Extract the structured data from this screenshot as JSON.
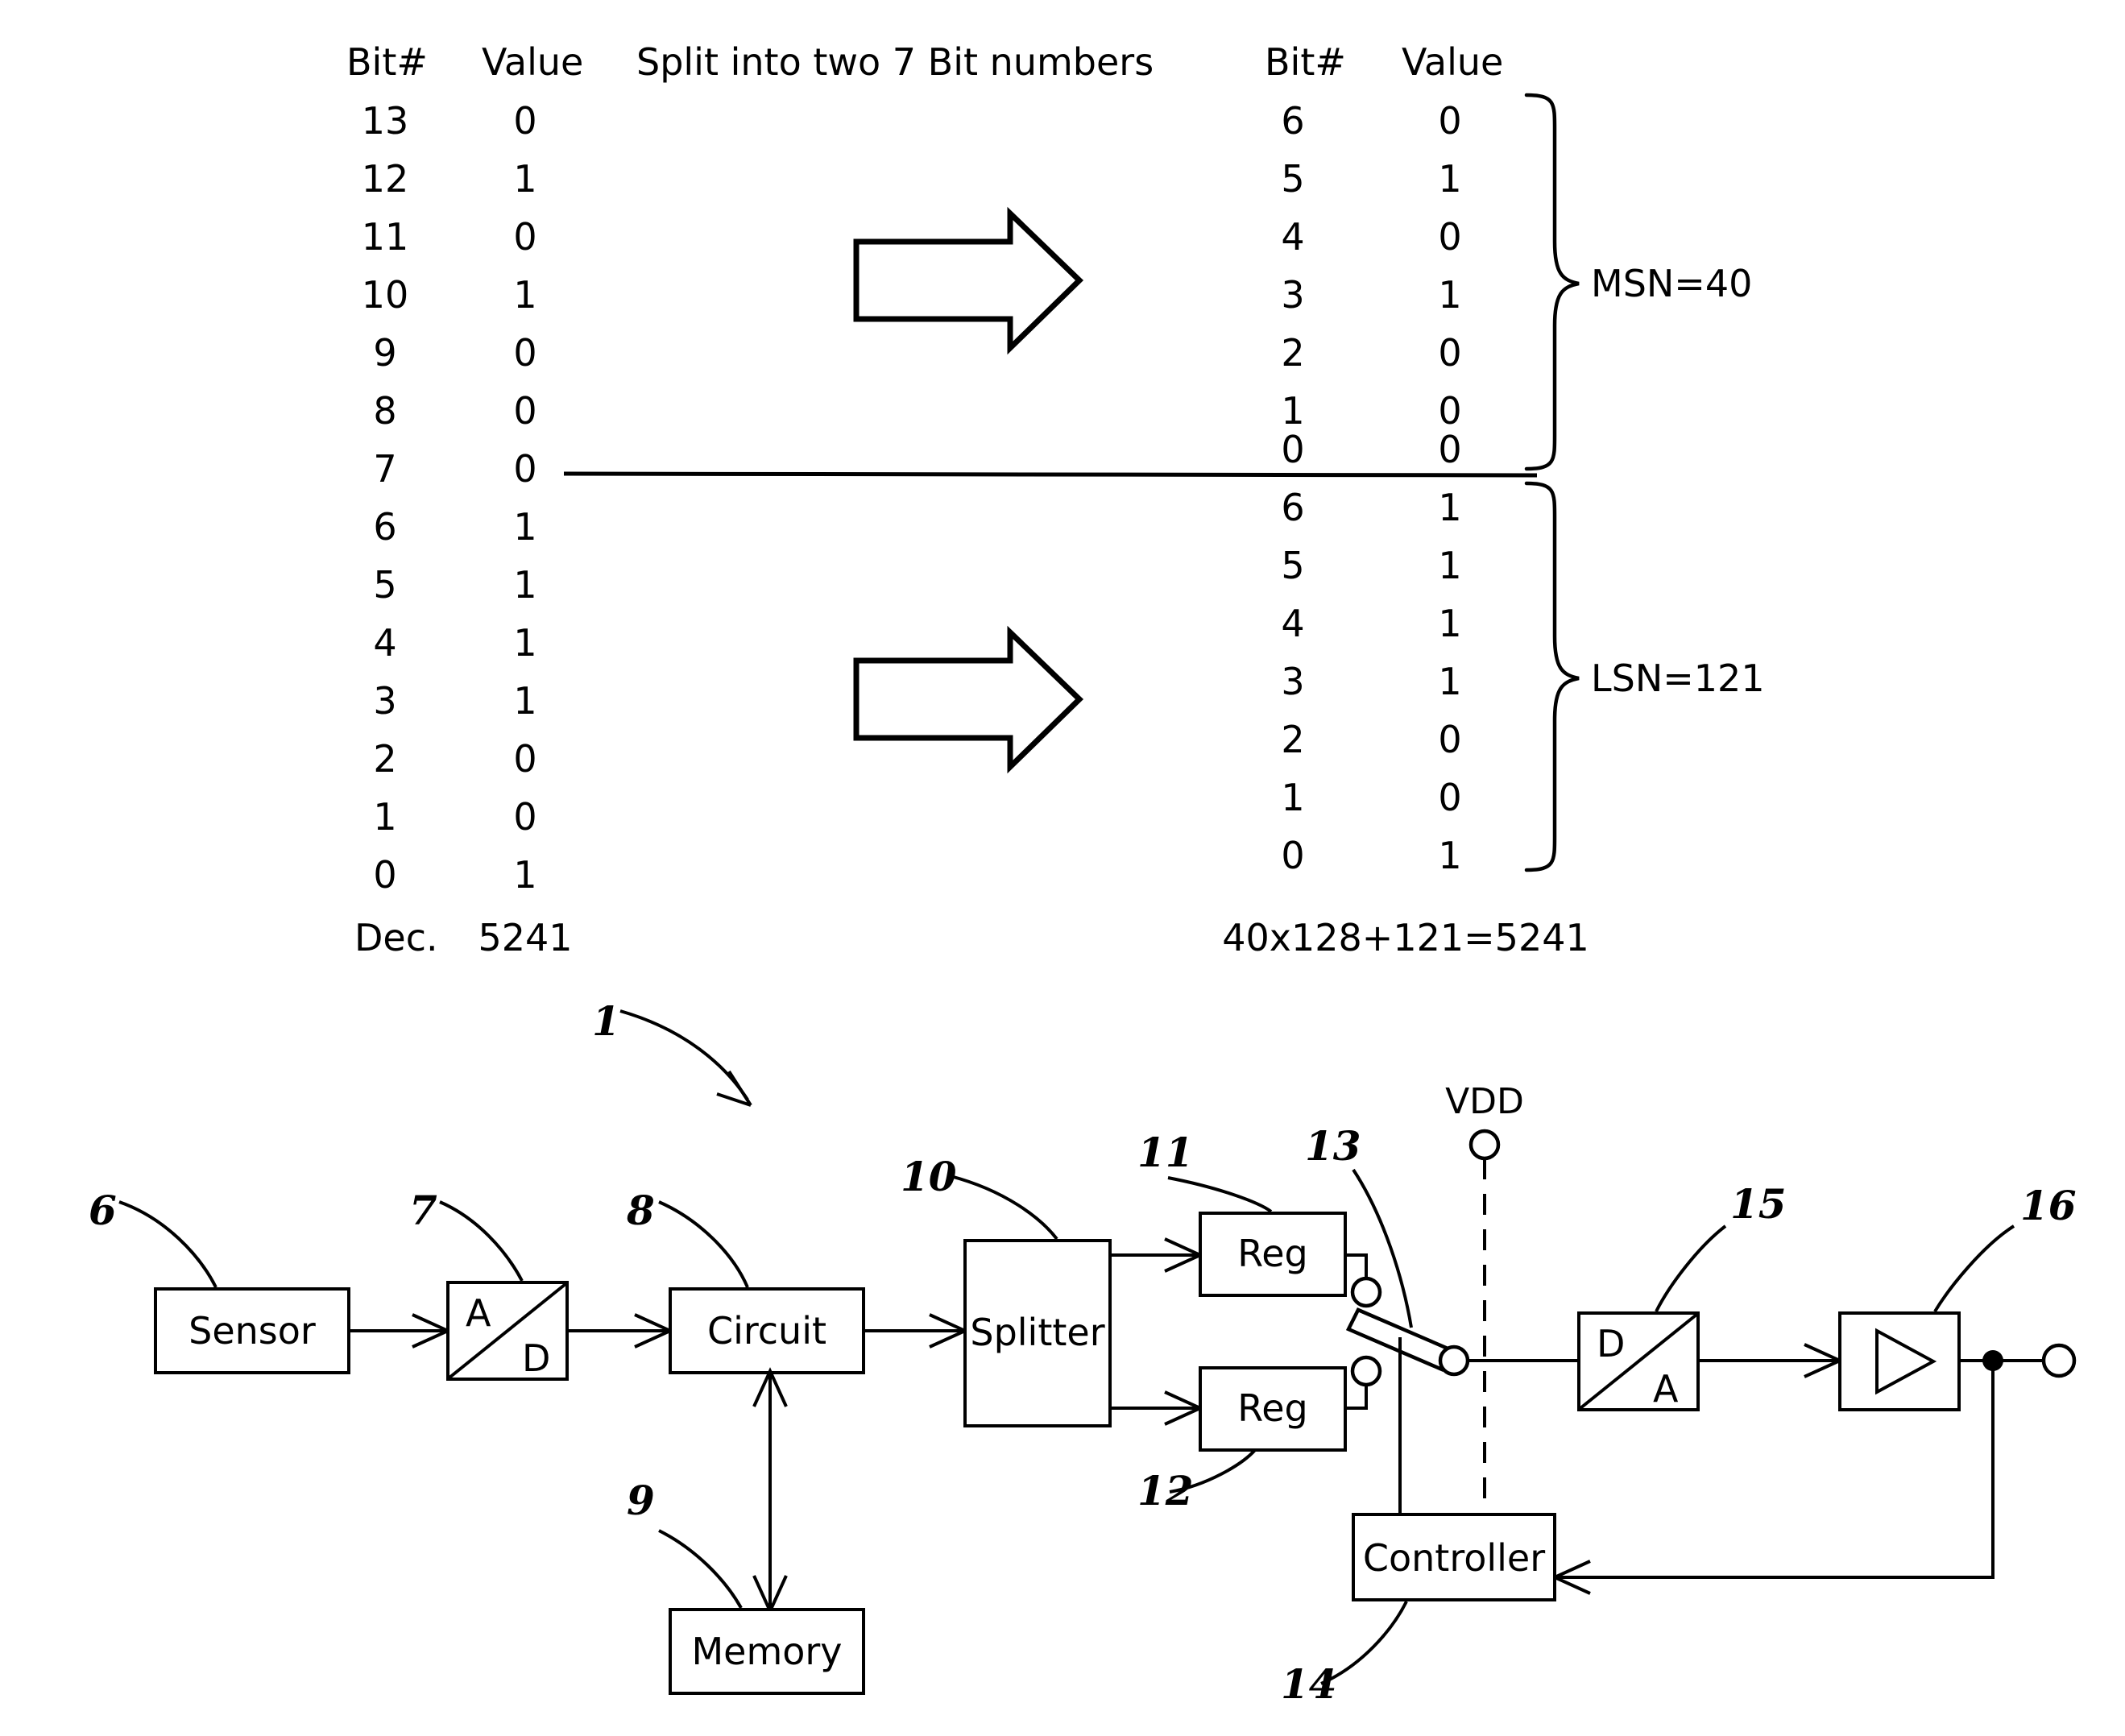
{
  "figure": {
    "title_note": "Split into two 7 Bit numbers"
  },
  "bit_table": {
    "headers": {
      "bit": "Bit#",
      "value": "Value"
    },
    "middle_caption": "Split into two 7 Bit numbers",
    "left": {
      "rows": [
        {
          "bit": "13",
          "value": "0"
        },
        {
          "bit": "12",
          "value": "1"
        },
        {
          "bit": "11",
          "value": "0"
        },
        {
          "bit": "10",
          "value": "1"
        },
        {
          "bit": "9",
          "value": "0"
        },
        {
          "bit": "8",
          "value": "0"
        },
        {
          "bit": "7",
          "value": "0"
        },
        {
          "bit": "6",
          "value": "1"
        },
        {
          "bit": "5",
          "value": "1"
        },
        {
          "bit": "4",
          "value": "1"
        },
        {
          "bit": "3",
          "value": "1"
        },
        {
          "bit": "2",
          "value": "0"
        },
        {
          "bit": "1",
          "value": "0"
        },
        {
          "bit": "0",
          "value": "1"
        }
      ],
      "footer_label": "Dec.",
      "footer_value": "5241"
    },
    "right": {
      "msn_rows": [
        {
          "bit": "6",
          "value": "0"
        },
        {
          "bit": "5",
          "value": "1"
        },
        {
          "bit": "4",
          "value": "0"
        },
        {
          "bit": "3",
          "value": "1"
        },
        {
          "bit": "2",
          "value": "0"
        },
        {
          "bit": "1",
          "value": "0"
        },
        {
          "bit": "0",
          "value": "0"
        }
      ],
      "lsn_rows": [
        {
          "bit": "6",
          "value": "1"
        },
        {
          "bit": "5",
          "value": "1"
        },
        {
          "bit": "4",
          "value": "1"
        },
        {
          "bit": "3",
          "value": "1"
        },
        {
          "bit": "2",
          "value": "0"
        },
        {
          "bit": "1",
          "value": "0"
        },
        {
          "bit": "0",
          "value": "1"
        }
      ],
      "msn_label": "MSN=40",
      "lsn_label": "LSN=121",
      "footer_equation": "40x128+121=5241"
    }
  },
  "block_diagram": {
    "system_ref": "1",
    "vdd_label": "VDD",
    "blocks": {
      "sensor": {
        "label": "Sensor",
        "ref": "6"
      },
      "adc": {
        "top": "A",
        "bottom": "D",
        "ref": "7"
      },
      "circuit": {
        "label": "Circuit",
        "ref": "8"
      },
      "memory": {
        "label": "Memory",
        "ref": "9"
      },
      "splitter": {
        "label": "Splitter",
        "ref": "10"
      },
      "reg_upper": {
        "label": "Reg",
        "ref": "11"
      },
      "reg_lower": {
        "label": "Reg",
        "ref": "12"
      },
      "switch": {
        "ref": "13"
      },
      "controller": {
        "label": "Controller",
        "ref": "14"
      },
      "dac": {
        "top": "D",
        "bottom": "A",
        "ref": "15"
      },
      "amplifier": {
        "ref": "16"
      }
    }
  },
  "colors": {
    "ink": "#000000",
    "paper": "#ffffff"
  }
}
